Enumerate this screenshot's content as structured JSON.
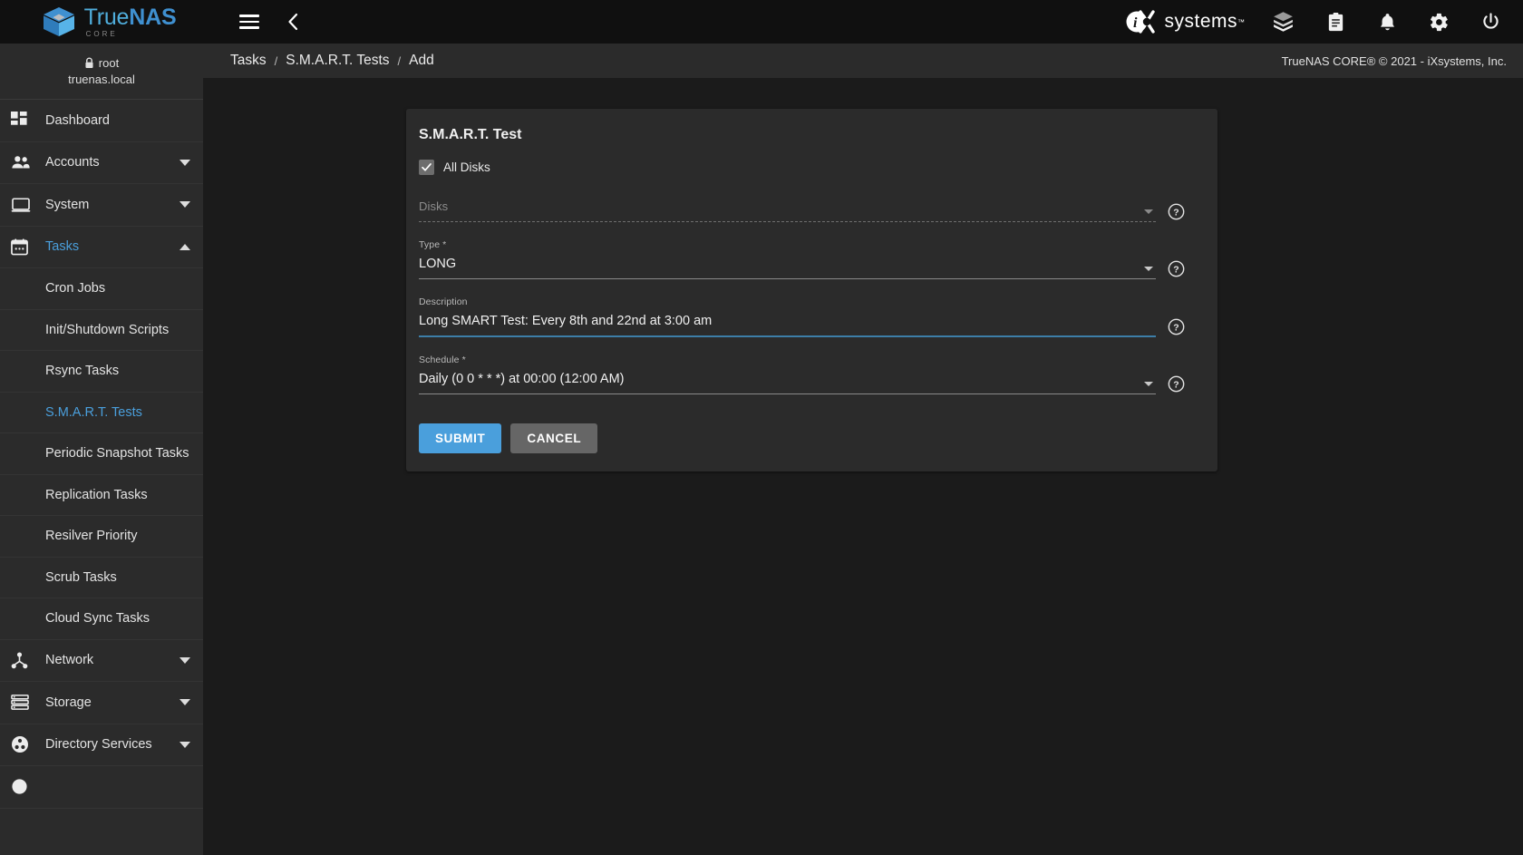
{
  "brand": {
    "name_part1": "True",
    "name_part2": "NAS",
    "subtitle": "CORE"
  },
  "topbar": {
    "menu_icon": "hamburger-menu-icon",
    "back_icon": "chevron-left-icon",
    "vendor_mark": "iX",
    "vendor_word": "systems",
    "vendor_tm": "™",
    "icons": [
      {
        "name": "cube-layers-icon",
        "label": "Jails / Plugins"
      },
      {
        "name": "clipboard-icon",
        "label": "Task Manager"
      },
      {
        "name": "bell-icon",
        "label": "Alerts"
      },
      {
        "name": "gear-icon",
        "label": "Settings"
      },
      {
        "name": "power-icon",
        "label": "Power"
      }
    ]
  },
  "sidebar": {
    "user": {
      "lock_icon": "lock-icon",
      "username": "root",
      "hostname": "truenas.local"
    },
    "items": [
      {
        "label": "Dashboard",
        "icon": "dashboard-grid-icon",
        "expandable": false,
        "active": false
      },
      {
        "label": "Accounts",
        "icon": "people-icon",
        "expandable": true,
        "expanded": false,
        "active": false
      },
      {
        "label": "System",
        "icon": "monitor-icon",
        "expandable": true,
        "expanded": false,
        "active": false
      },
      {
        "label": "Tasks",
        "icon": "calendar-icon",
        "expandable": true,
        "expanded": true,
        "active": true
      },
      {
        "label": "Network",
        "icon": "network-node-icon",
        "expandable": true,
        "expanded": false,
        "active": false
      },
      {
        "label": "Storage",
        "icon": "storage-stack-icon",
        "expandable": true,
        "expanded": false,
        "active": false
      },
      {
        "label": "Directory Services",
        "icon": "directory-services-icon",
        "expandable": true,
        "expanded": false,
        "active": false
      }
    ],
    "tasks_submenu": [
      {
        "label": "Cron Jobs",
        "active": false
      },
      {
        "label": "Init/Shutdown Scripts",
        "active": false
      },
      {
        "label": "Rsync Tasks",
        "active": false
      },
      {
        "label": "S.M.A.R.T. Tests",
        "active": true
      },
      {
        "label": "Periodic Snapshot Tasks",
        "active": false
      },
      {
        "label": "Replication Tasks",
        "active": false
      },
      {
        "label": "Resilver Priority",
        "active": false
      },
      {
        "label": "Scrub Tasks",
        "active": false
      },
      {
        "label": "Cloud Sync Tasks",
        "active": false
      }
    ]
  },
  "breadcrumb": {
    "items": [
      "Tasks",
      "S.M.A.R.T. Tests",
      "Add"
    ],
    "separator": "/",
    "copyright": "TrueNAS CORE® © 2021 - iXsystems, Inc."
  },
  "form": {
    "title": "S.M.A.R.T. Test",
    "all_disks": {
      "label": "All Disks",
      "checked": true,
      "check_icon": "checkmark-icon"
    },
    "fields": [
      {
        "name": "disks",
        "label": "Disks",
        "value": "",
        "disabled": true,
        "required": false,
        "control": "select",
        "underline": "dotted",
        "help_icon": "help-circle-icon"
      },
      {
        "name": "type",
        "label": "Type *",
        "value": "LONG",
        "disabled": false,
        "required": true,
        "control": "select",
        "underline": "solid",
        "help_icon": "help-circle-icon"
      },
      {
        "name": "description",
        "label": "Description",
        "value": "Long SMART Test: Every 8th and 22nd at 3:00 am",
        "disabled": false,
        "required": false,
        "control": "text",
        "underline": "blue",
        "help_icon": "help-circle-icon"
      },
      {
        "name": "schedule",
        "label": "Schedule *",
        "value": "Daily (0 0 * * *) at 00:00 (12:00 AM)",
        "disabled": false,
        "required": true,
        "control": "select",
        "underline": "solid",
        "help_icon": "help-circle-icon"
      }
    ],
    "submit_label": "SUBMIT",
    "cancel_label": "CANCEL"
  },
  "colors": {
    "accent": "#4a9fdc",
    "topbar_bg": "#101010",
    "sidebar_bg": "#2b2b2b",
    "card_bg": "#2b2b2b",
    "page_bg": "#1b1b1b",
    "cancel_btn": "#666666",
    "focus_underline": "#3d7ea8"
  }
}
